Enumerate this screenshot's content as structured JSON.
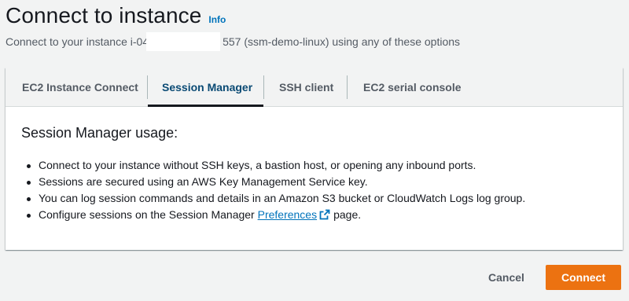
{
  "header": {
    "title": "Connect to instance",
    "info_label": "Info",
    "subtitle_prefix": "Connect to your instance i-04",
    "subtitle_suffix": "557 (ssm-demo-linux) using any of these options"
  },
  "tabs": [
    {
      "label": "EC2 Instance Connect"
    },
    {
      "label": "Session Manager",
      "active": true
    },
    {
      "label": "SSH client"
    },
    {
      "label": "EC2 serial console"
    }
  ],
  "panel": {
    "heading": "Session Manager usage:",
    "bullets": [
      "Connect to your instance without SSH keys, a bastion host, or opening any inbound ports.",
      "Sessions are secured using an AWS Key Management Service key.",
      "You can log session commands and details in an Amazon S3 bucket or CloudWatch Logs log group."
    ],
    "last_bullet": {
      "prefix": "Configure sessions on the Session Manager",
      "link": "Preferences",
      "link_icon": "external-link-icon",
      "suffix": "page."
    }
  },
  "footer": {
    "cancel_label": "Cancel",
    "connect_label": "Connect"
  },
  "colors": {
    "background": "#f2f3f3",
    "link": "#0073bb",
    "active_tab": "#0a4a74",
    "primary_button": "#ec7211",
    "text": "#16191f",
    "secondary_text": "#545b64"
  }
}
